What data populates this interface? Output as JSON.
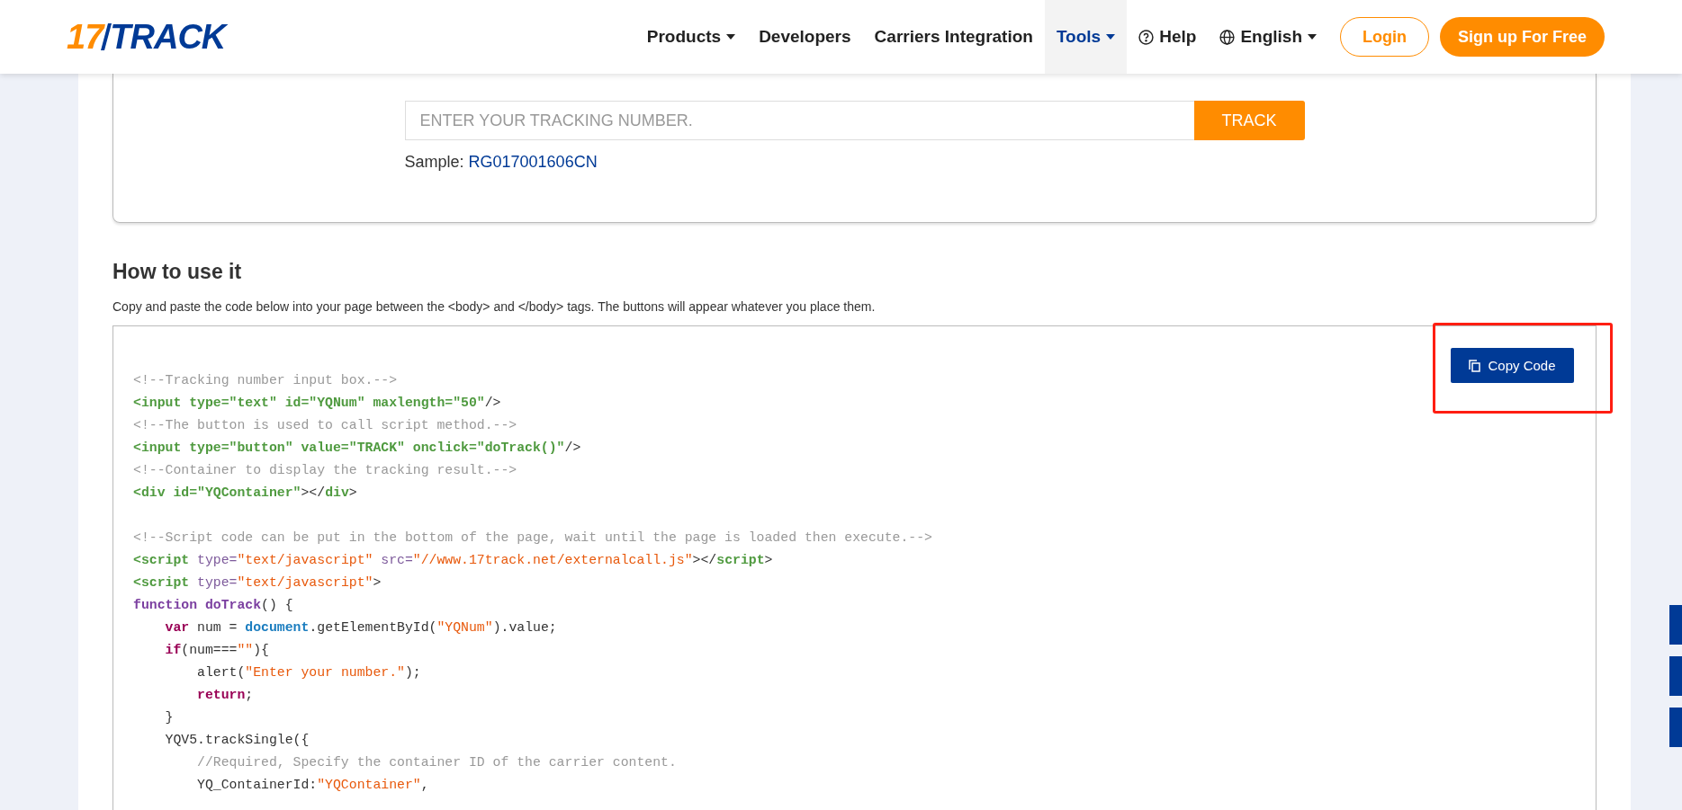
{
  "header": {
    "logo": {
      "number": "17",
      "word": "TRACK"
    },
    "nav": [
      {
        "label": "Products",
        "kind": "plain",
        "caret": true,
        "selected": false
      },
      {
        "label": "Developers",
        "kind": "plain",
        "caret": false,
        "selected": false
      },
      {
        "label": "Carriers Integration",
        "kind": "plain",
        "caret": false,
        "selected": false
      },
      {
        "label": "Tools",
        "kind": "plain",
        "caret": true,
        "selected": true
      },
      {
        "label": "Help",
        "kind": "help",
        "caret": false,
        "selected": false
      },
      {
        "label": "English",
        "kind": "language",
        "caret": true,
        "selected": false
      }
    ],
    "login": "Login",
    "signup": "Sign up For Free"
  },
  "tracker": {
    "placeholder": "ENTER YOUR TRACKING NUMBER.",
    "button": "TRACK",
    "sample_label": "Sample:",
    "sample_number": "RG017001606CN"
  },
  "how_to": {
    "title": "How to use it",
    "description": "Copy and paste the code below into your page between the <body> and </body> tags. The buttons will appear whatever you place them.",
    "copy_button": {
      "label": "Copy Code",
      "highlighted": true
    },
    "lines": [
      {
        "kind": "code",
        "tokens": [
          {
            "kind": "comment",
            "text": "<!--Tracking number input box.-->"
          }
        ]
      },
      {
        "kind": "code",
        "tokens": [
          {
            "kind": "tag",
            "text": "<input type=\"text\" id=\"YQNum\" maxlength=\"50\""
          },
          {
            "kind": "plain",
            "text": "/>"
          }
        ]
      },
      {
        "kind": "code",
        "tokens": [
          {
            "kind": "comment",
            "text": "<!--The button is used to call script method.-->"
          }
        ]
      },
      {
        "kind": "code",
        "tokens": [
          {
            "kind": "tag",
            "text": "<input type=\"button\" value=\"TRACK\" onclick=\"doTrack()\""
          },
          {
            "kind": "plain",
            "text": "/>"
          }
        ]
      },
      {
        "kind": "code",
        "tokens": [
          {
            "kind": "comment",
            "text": "<!--Container to display the tracking result.-->"
          }
        ]
      },
      {
        "kind": "code",
        "tokens": [
          {
            "kind": "tag",
            "text": "<div id=\"YQContainer\""
          },
          {
            "kind": "plain",
            "text": "></"
          },
          {
            "kind": "tag",
            "text": "div"
          },
          {
            "kind": "plain",
            "text": ">"
          }
        ]
      },
      {
        "kind": "blank"
      },
      {
        "kind": "code",
        "tokens": [
          {
            "kind": "comment",
            "text": "<!--Script code can be put in the bottom of the page, wait until the page is loaded then execute.-->"
          }
        ]
      },
      {
        "kind": "code",
        "tokens": [
          {
            "kind": "tag",
            "text": "<script"
          },
          {
            "kind": "attr",
            "text": " type="
          },
          {
            "kind": "string",
            "text": "\"text/javascript\""
          },
          {
            "kind": "attr",
            "text": " src="
          },
          {
            "kind": "string",
            "text": "\"//www.17track.net/externalcall.js\""
          },
          {
            "kind": "plain",
            "text": "></"
          },
          {
            "kind": "tag",
            "text": "script"
          },
          {
            "kind": "plain",
            "text": ">"
          }
        ]
      },
      {
        "kind": "code",
        "tokens": [
          {
            "kind": "tag",
            "text": "<script"
          },
          {
            "kind": "attr",
            "text": " type="
          },
          {
            "kind": "string",
            "text": "\"text/javascript\""
          },
          {
            "kind": "plain",
            "text": ">"
          }
        ]
      },
      {
        "kind": "code",
        "tokens": [
          {
            "kind": "func",
            "text": "function doTrack"
          },
          {
            "kind": "plain",
            "text": "() {"
          }
        ]
      },
      {
        "kind": "code",
        "tokens": [
          {
            "kind": "keyword",
            "text": "    var"
          },
          {
            "kind": "plain",
            "text": " num = "
          },
          {
            "kind": "builtin",
            "text": "document"
          },
          {
            "kind": "plain",
            "text": ".getElementById("
          },
          {
            "kind": "string",
            "text": "\"YQNum\""
          },
          {
            "kind": "plain",
            "text": ").value;"
          }
        ]
      },
      {
        "kind": "code",
        "tokens": [
          {
            "kind": "keyword",
            "text": "    if"
          },
          {
            "kind": "plain",
            "text": "(num==="
          },
          {
            "kind": "string",
            "text": "\"\""
          },
          {
            "kind": "plain",
            "text": "){"
          }
        ]
      },
      {
        "kind": "code",
        "tokens": [
          {
            "kind": "plain",
            "text": "        alert("
          },
          {
            "kind": "string",
            "text": "\"Enter your number.\""
          },
          {
            "kind": "plain",
            "text": ");"
          }
        ]
      },
      {
        "kind": "code",
        "tokens": [
          {
            "kind": "keyword",
            "text": "        return"
          },
          {
            "kind": "plain",
            "text": ";"
          }
        ]
      },
      {
        "kind": "code",
        "tokens": [
          {
            "kind": "plain",
            "text": "    }"
          }
        ]
      },
      {
        "kind": "code",
        "tokens": [
          {
            "kind": "plain",
            "text": "    YQV5.trackSingle({"
          }
        ]
      },
      {
        "kind": "code",
        "tokens": [
          {
            "kind": "comment",
            "text": "        //Required, Specify the container ID of the carrier content."
          }
        ]
      },
      {
        "kind": "code",
        "tokens": [
          {
            "kind": "plain",
            "text": "        YQ_ContainerId:"
          },
          {
            "kind": "string",
            "text": "\"YQContainer\""
          },
          {
            "kind": "plain",
            "text": ","
          }
        ]
      }
    ]
  }
}
